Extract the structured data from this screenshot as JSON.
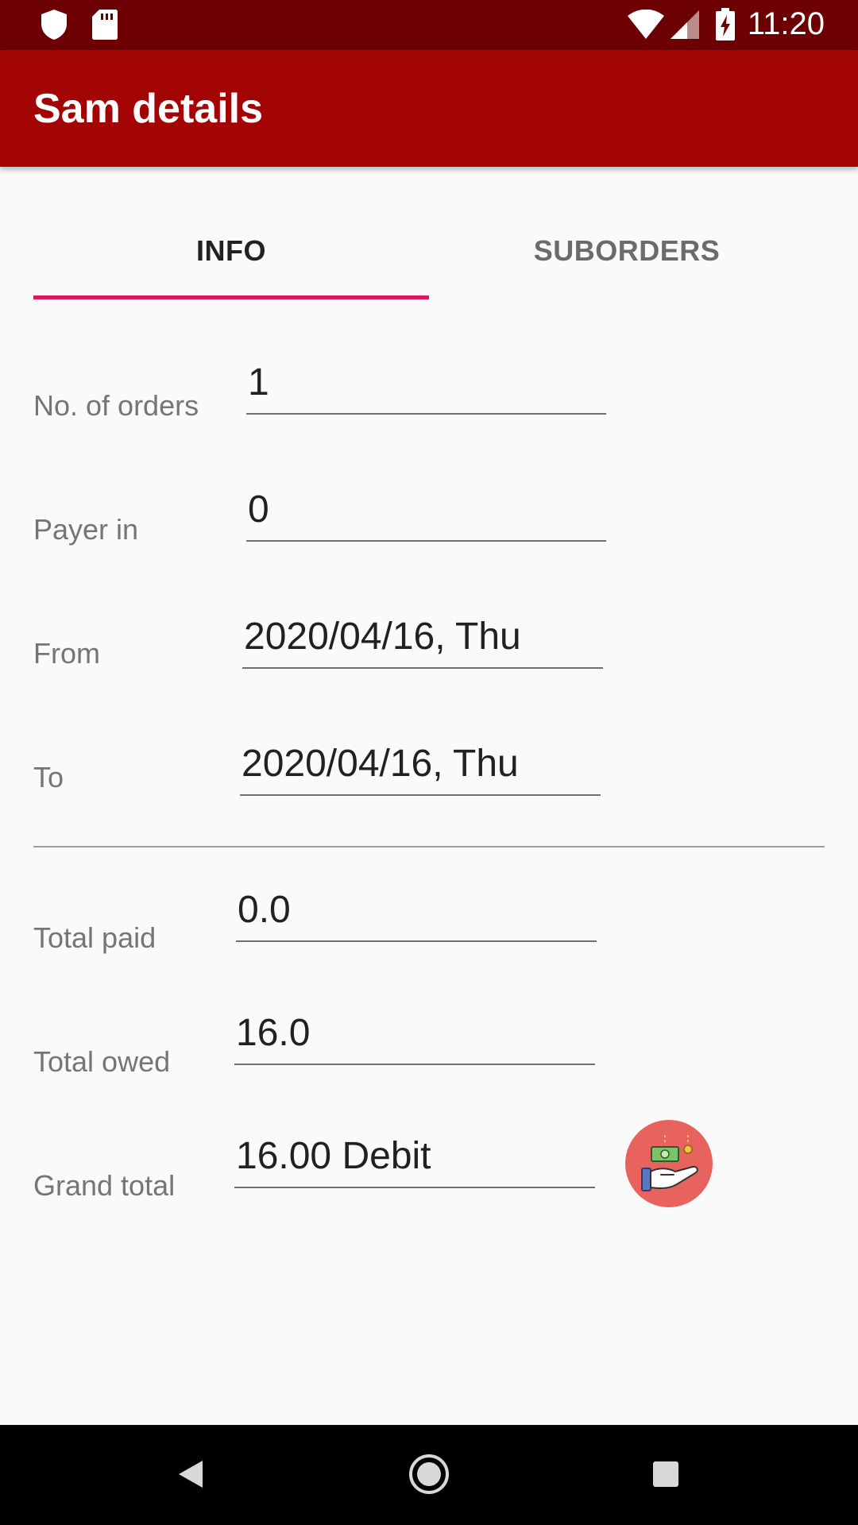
{
  "status_bar": {
    "time": "11:20",
    "icons": [
      "shield-icon",
      "sd-card-icon",
      "wifi-icon",
      "signal-icon",
      "battery-charging-icon"
    ]
  },
  "app_bar": {
    "title": "Sam details"
  },
  "tabs": [
    {
      "label": "INFO",
      "selected": true
    },
    {
      "label": "SUBORDERS",
      "selected": false
    }
  ],
  "fields": {
    "orders": {
      "label": "No. of orders",
      "value": "1"
    },
    "payer_in": {
      "label": "Payer in",
      "value": "0"
    },
    "from": {
      "label": "From",
      "value": "2020/04/16, Thu"
    },
    "to": {
      "label": "To",
      "value": "2020/04/16, Thu"
    },
    "total_paid": {
      "label": "Total paid",
      "value": "0.0"
    },
    "total_owed": {
      "label": "Total owed",
      "value": "16.0"
    },
    "grand_total": {
      "label": "Grand total",
      "value": "16.00 Debit"
    }
  },
  "colors": {
    "status_bar": "#6c0003",
    "app_bar": "#a30404",
    "tab_indicator": "#d81b60",
    "pay_icon_bg": "#e8635e"
  },
  "nav_bar": {
    "icons": [
      "back-icon",
      "home-icon",
      "recents-icon"
    ]
  }
}
